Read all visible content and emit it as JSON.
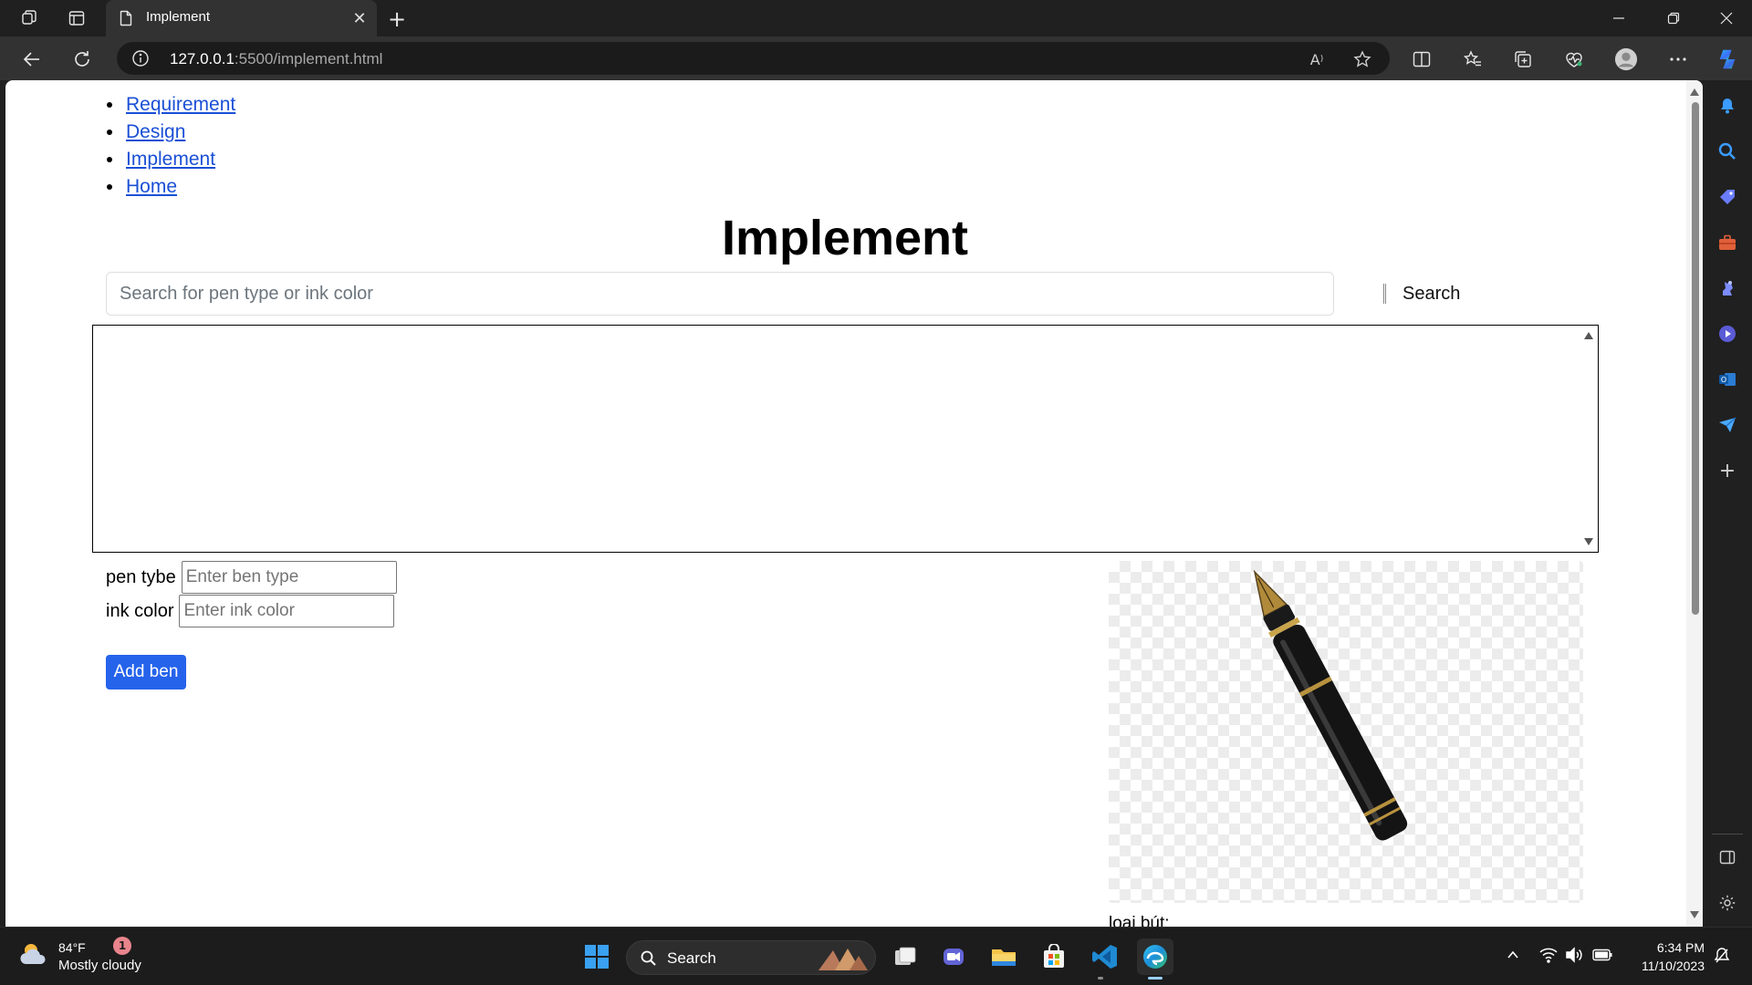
{
  "browser": {
    "tab_title": "Implement",
    "url_host": "127.0.0.1",
    "url_rest": ":5500/implement.html"
  },
  "nav": {
    "links": [
      "Requirement",
      "Design",
      "Implement",
      "Home"
    ]
  },
  "page": {
    "title": "Implement",
    "search_placeholder": "Search for pen type or ink color",
    "search_button": "Search",
    "pen_type_label": "pen tybe",
    "pen_type_placeholder": "Enter ben type",
    "ink_color_label": "ink color",
    "ink_color_placeholder": "Enter ink color",
    "add_button": "Add ben",
    "image_caption": "loại bút:"
  },
  "taskbar": {
    "temperature": "84°F",
    "weather": "Mostly cloudy",
    "notification_count": "1",
    "search_label": "Search",
    "time": "6:34 PM",
    "date": "11/10/2023"
  },
  "colors": {
    "link": "#1a4fd6",
    "primary_button": "#2563eb",
    "browser_chrome": "#202020"
  }
}
